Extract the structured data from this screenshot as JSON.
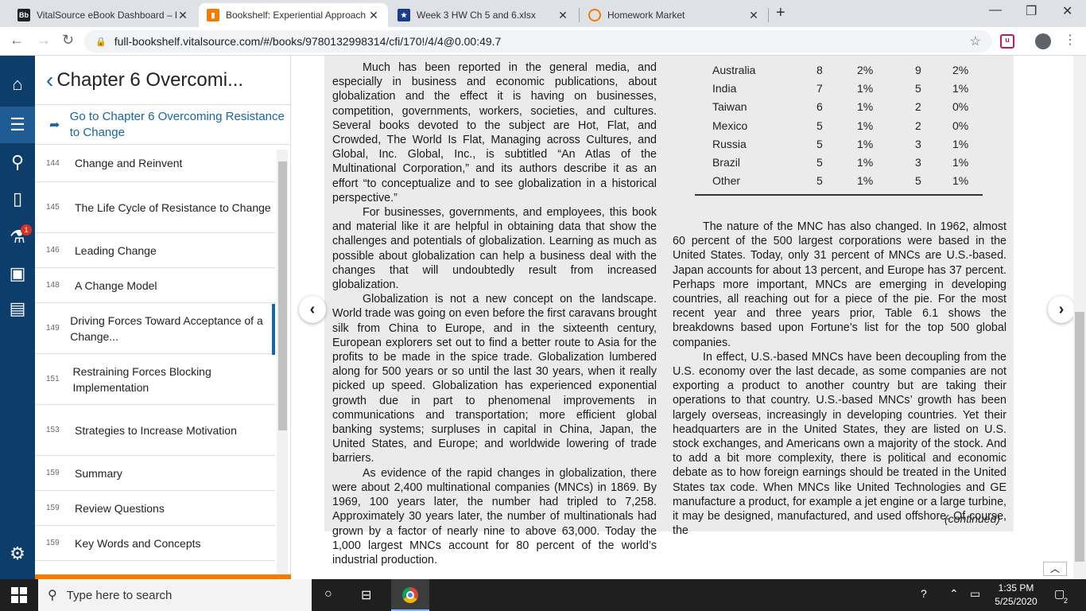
{
  "browser": {
    "tabs": [
      {
        "favicon": "Bb",
        "title": "VitalSource eBook Dashboard – E",
        "active": false
      },
      {
        "favicon": "bookmark-icon",
        "title": "Bookshelf: Experiential Approach",
        "active": true
      },
      {
        "favicon": "star-icon",
        "title": "Week 3 HW Ch 5 and 6.xlsx",
        "active": false
      },
      {
        "favicon": "homework-market-icon",
        "title": "Homework Market",
        "active": false
      }
    ],
    "url": "full-bookshelf.vitalsource.com/#/books/9780132998314/cfi/170!/4/4@0.00:49.7",
    "close_glyph": "✕",
    "new_tab_glyph": "+"
  },
  "sidebar": {
    "chapter_title": "Chapter 6 Overcomi...",
    "goto_label": "Go to Chapter 6 Overcoming Resistance to Change",
    "badge_count": "1",
    "items": [
      {
        "page": "144",
        "label": "Change and Reinvent"
      },
      {
        "page": "145",
        "label": "The Life Cycle of Resistance to Change"
      },
      {
        "page": "146",
        "label": "Leading Change"
      },
      {
        "page": "148",
        "label": "A Change Model"
      },
      {
        "page": "149",
        "label": "Driving Forces Toward Acceptance of a Change..."
      },
      {
        "page": "151",
        "label": "Restraining Forces Blocking Implementation"
      },
      {
        "page": "153",
        "label": "Strategies to Increase Motivation"
      },
      {
        "page": "159",
        "label": "Summary"
      },
      {
        "page": "159",
        "label": "Review Questions"
      },
      {
        "page": "159",
        "label": "Key Words and Concepts"
      }
    ]
  },
  "table": {
    "rows": [
      {
        "country": "Australia",
        "a": "8",
        "b": "2%",
        "c": "9",
        "d": "2%"
      },
      {
        "country": "India",
        "a": "7",
        "b": "1%",
        "c": "5",
        "d": "1%"
      },
      {
        "country": "Taiwan",
        "a": "6",
        "b": "1%",
        "c": "2",
        "d": "0%"
      },
      {
        "country": "Mexico",
        "a": "5",
        "b": "1%",
        "c": "2",
        "d": "0%"
      },
      {
        "country": "Russia",
        "a": "5",
        "b": "1%",
        "c": "3",
        "d": "1%"
      },
      {
        "country": "Brazil",
        "a": "5",
        "b": "1%",
        "c": "3",
        "d": "1%"
      },
      {
        "country": "Other",
        "a": "5",
        "b": "1%",
        "c": "5",
        "d": "1%"
      }
    ]
  },
  "page_text": {
    "left": [
      "Much has been reported in the general media, and especially in business and economic publications, about globalization and the effect it is having on businesses, competition, governments, workers, societies, and cultures. Several books devoted to the subject are Hot, Flat, and Crowded, The World Is Flat, Managing across Cultures, and Global, Inc. Global, Inc., is subtitled “An Atlas of the Multinational Corporation,” and its authors describe it as an effort “to conceptualize and to see globalization in a historical perspective.”",
      "For businesses, governments, and employees, this book and material like it are helpful in obtaining data that show the challenges and potentials of globalization. Learning as much as possible about globalization can help a business deal with the changes that will undoubtedly result from increased globalization.",
      "Globalization is not a new concept on the landscape. World trade was going on even before the first caravans brought silk from China to Europe, and in the sixteenth century, European explorers set out to find a better route to Asia for the profits to be made in the spice trade. Globalization lumbered along for 500 years or so until the last 30 years, when it really picked up speed. Globalization has experienced exponential growth due in part to phenomenal improvements in communications and transportation; more efficient global banking systems; surpluses in capital in China, Japan, the United States, and Europe; and worldwide lowering of trade barriers.",
      "As evidence of the rapid changes in globalization, there were about 2,400 multinational companies (MNCs) in 1869. By 1969, 100 years later, the number had tripled to 7,258. Approximately 30 years later, the number of multinationals had grown by a factor of nearly nine to above 63,000. Today the 1,000 largest MNCs account for 80 percent of the world’s industrial production."
    ],
    "right": [
      "The nature of the MNC has also changed. In 1962, almost 60 percent of the 500 largest corporations were based in the United States. Today, only 31 percent of MNCs are U.S.-based. Japan accounts for about 13 percent, and Europe has 37 percent. Perhaps more important, MNCs are emerging in developing countries, all reaching out for a piece of the pie. For the most recent year and three years prior, Table 6.1 shows the breakdowns based upon Fortune’s list for the top 500 global companies.",
      "In effect, U.S.-based MNCs have been decoupling from the U.S. economy over the last decade, as some companies are not exporting a product to another country but are taking their operations to that country. U.S.-based MNCs’ growth has been largely overseas, increasingly in developing countries. Yet their headquarters are in the United States, they are listed on U.S. stock exchanges, and Americans own a majority of the stock. And to add a bit more complexity, there is political and economic debate as to how foreign earnings should be treated in the United States tax code. When MNCs like United Technologies and GE manufacture a product, for example a jet engine or a large turbine, it may be designed, manufactured, and used offshore. Of course, the"
    ],
    "continued": "(continued)"
  },
  "taskbar": {
    "search_placeholder": "Type here to search",
    "time": "1:35 PM",
    "date": "5/25/2020",
    "notification_count": "2"
  }
}
